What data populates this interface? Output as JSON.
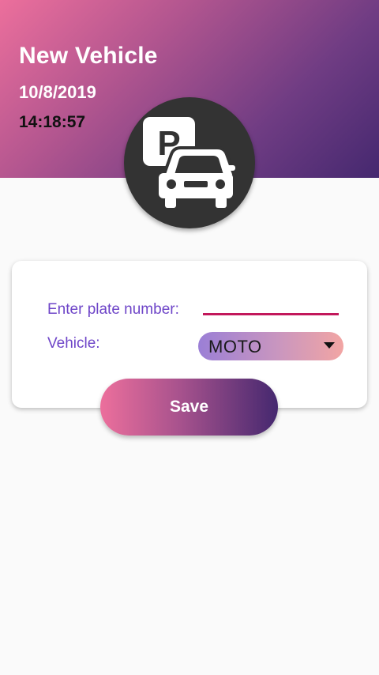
{
  "header": {
    "title": "New Vehicle",
    "date": "10/8/2019",
    "time": "14:18:57",
    "logo_icon": "parking-car-icon",
    "gradient_colors": [
      "#ec6f9c",
      "#45286f"
    ]
  },
  "form": {
    "plate_label": "Enter plate number:",
    "plate_value": "",
    "plate_placeholder": "",
    "vehicle_label": "Vehicle:",
    "vehicle_selected": "MOTO",
    "dropdown_icon": "caret-down-icon"
  },
  "actions": {
    "save_label": "Save"
  },
  "colors": {
    "label": "#6e45c8",
    "underline": "#c2185b",
    "logo_bg": "#333333"
  }
}
